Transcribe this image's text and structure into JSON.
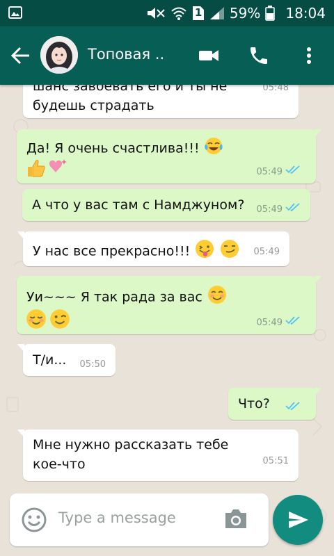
{
  "status_bar": {
    "battery": "59%",
    "time": "18:04",
    "sim_badge": "1"
  },
  "header": {
    "contact_name": "Топовая ..",
    "icons": [
      "back-arrow-icon",
      "video-call-icon",
      "phone-icon",
      "more-vert-icon"
    ]
  },
  "messages": [
    {
      "side": "in",
      "lines": [
        "шанс завоевать его и ты не",
        "будешь страдать"
      ],
      "time": "05:48"
    },
    {
      "side": "out",
      "lines": [
        "Да! Я очень счастлива!!!"
      ],
      "time": "05:49",
      "emoji": [
        "tears-of-joy",
        "thumbs-up",
        "sparkling-heart"
      ]
    },
    {
      "side": "out",
      "lines": [
        "А что у вас там с Намджуном?"
      ],
      "time": "05:49"
    },
    {
      "side": "in",
      "lines": [
        "У нас все прекрасно!!!"
      ],
      "time": "05:49",
      "emoji": [
        "tongue-wink",
        "smirk"
      ]
    },
    {
      "side": "out",
      "lines": [
        "Уи~~~ Я так рада за вас"
      ],
      "time": "05:49",
      "emoji": [
        "smiling-blush",
        "relieved",
        "wink"
      ]
    },
    {
      "side": "in",
      "lines": [
        "Т/и..."
      ],
      "time": "05:50"
    },
    {
      "side": "out",
      "lines": [
        "Что?"
      ],
      "time": ""
    },
    {
      "side": "in",
      "lines": [
        "Мне нужно рассказать тебе",
        "кое-что"
      ],
      "time": "05:51"
    }
  ],
  "composer": {
    "placeholder": "Type a message",
    "icons": [
      "emoji-icon",
      "camera-icon",
      "send-icon"
    ]
  },
  "colors": {
    "status_bar": "#054d44",
    "app_bar": "#075e54",
    "outgoing_bubble": "#dcf8c6",
    "incoming_bubble": "#ffffff",
    "send_button": "#128c7e",
    "read_ticks": "#4fc3f7",
    "chat_background": "#e9e2d8"
  }
}
